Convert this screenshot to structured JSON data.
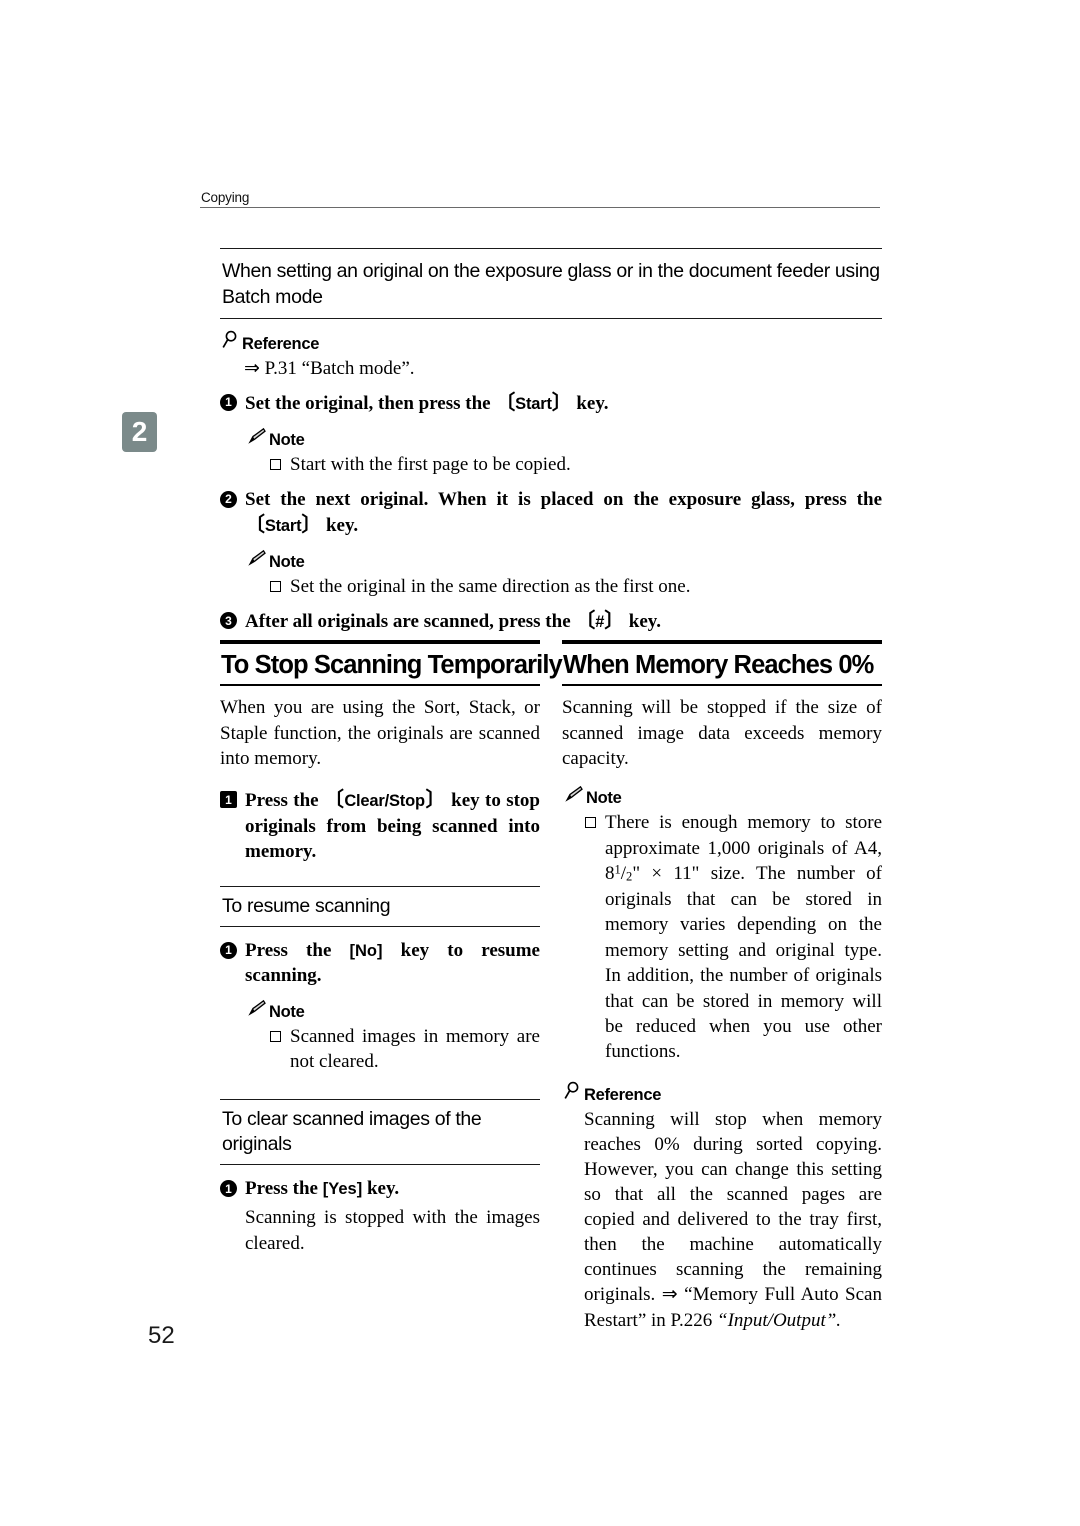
{
  "running_header": {
    "label": "Copying"
  },
  "chapter_tab": {
    "number": "2"
  },
  "folio": {
    "page_number": "52"
  },
  "top_section": {
    "subheading": "When setting an original on the exposure glass or in the document feeder using Batch mode",
    "reference": {
      "icon": "magnifier-icon",
      "label": "Reference",
      "text": "⇒ P.31 “Batch mode”."
    },
    "steps": [
      {
        "marker": "1",
        "marker_shape": "circle",
        "text_before": "Set the original, then press the ",
        "key": "Start",
        "text_after": " key."
      },
      {
        "marker": "2",
        "marker_shape": "circle",
        "text_before": "Set the next original. When it is placed on the exposure glass, press the ",
        "key": "Start",
        "text_after": " key."
      },
      {
        "marker": "3",
        "marker_shape": "circle",
        "text_before": "After all originals are scanned, press the ",
        "key": "#",
        "text_after": " key."
      }
    ],
    "notes": [
      {
        "icon": "pencil-icon",
        "label": "Note",
        "items": [
          "Start with the first page to be copied."
        ]
      },
      {
        "icon": "pencil-icon",
        "label": "Note",
        "items": [
          "Set the original in the same direction as the first one."
        ]
      }
    ]
  },
  "left_column": {
    "section_title": "To Stop Scanning Temporarily",
    "intro": "When you are using the Sort, Stack, or Staple function, the originals are scanned into memory.",
    "step": {
      "marker": "1",
      "marker_shape": "square",
      "text_before": "Press the ",
      "key": "Clear/Stop",
      "text_after": " key to stop originals from being scanned into memory."
    },
    "subsection_1": {
      "heading": "To resume scanning",
      "step": {
        "marker": "1",
        "marker_shape": "circle",
        "text_before": "Press the ",
        "key": "No",
        "key_style": "square",
        "text_after": " key to resume scanning."
      },
      "note": {
        "icon": "pencil-icon",
        "label": "Note",
        "items": [
          "Scanned images in memory are not cleared."
        ]
      }
    },
    "subsection_2": {
      "heading": "To clear scanned images of the originals",
      "step": {
        "marker": "1",
        "marker_shape": "circle",
        "text_before": "Press the ",
        "key": "Yes",
        "key_style": "square",
        "text_after": " key."
      },
      "step_body": "Scanning is stopped with the images cleared."
    }
  },
  "right_column": {
    "section_title": "When Memory Reaches 0%",
    "intro": "Scanning will be stopped if the size of scanned image data exceeds memory capacity.",
    "note": {
      "icon": "pencil-icon",
      "label": "Note",
      "item_part1": "There is enough memory to store approximate 1,000 originals of A4, 8",
      "frac_numerator": "1",
      "frac_denominator": "2",
      "item_part2": "\" × 11\" size. The number of originals that can be stored in memory varies depending on the memory setting and original type. In addition, the number of originals that can be stored in memory will be reduced when you use other functions."
    },
    "reference": {
      "icon": "magnifier-icon",
      "label": "Reference",
      "text_plain": "Scanning will stop when memory reaches 0% during sorted copying. However, you can change this setting so that all the scanned pages are copied and delivered to the tray first, then the machine automatically continues scanning the remaining originals. ⇒ “Memory Full Auto Scan Restart” in P.226 ",
      "text_italic": "“Input/Output”."
    }
  }
}
